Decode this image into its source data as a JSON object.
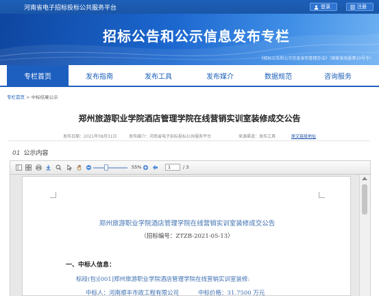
{
  "topbar": {
    "title": "河南省电子招标投标公共服务平台",
    "login_label": "登录",
    "register_label": "注册"
  },
  "banner": {
    "heading": "招标公告和公示信息发布专栏",
    "notice": "《招标公告和公示信息发布管理办法》（国家发改委第10号令）"
  },
  "nav": {
    "tabs": [
      {
        "label": "专栏首页",
        "active": true
      },
      {
        "label": "发布指南"
      },
      {
        "label": "发布工具"
      },
      {
        "label": "发布媒介"
      },
      {
        "label": "数据规范"
      },
      {
        "label": "咨询服务"
      }
    ]
  },
  "breadcrumb": {
    "home": "专栏首页",
    "sep": " > ",
    "current": "中标结果公示"
  },
  "article": {
    "title": "郑州旅游职业学院酒店管理学院在线营销实训室装修成交公告",
    "publish_date": "发布日期：2021年08月31日",
    "media": "发布媒介：河南省电子招标投标公共服务平台",
    "source": "来源渠道：发布工具",
    "source_link": "原文链接地址"
  },
  "section": {
    "num": "01",
    "label": "公示内容"
  },
  "viewer": {
    "zoom": "55%",
    "page": "1",
    "page_total": "/ 3"
  },
  "doc": {
    "title": "郑州旅游职业学院酒店管理学院在线营销实训室装修成交公告",
    "code": "（招标编号：ZTZB-2021-05-13）",
    "section_heading": "一、中标人信息：",
    "lot_line": "标段(包)[001]郑州旅游职业学院酒店管理学院在线营销实训室装修:",
    "winner_label": "中标人：",
    "winner": "河南顺丰市政工程有限公司",
    "price_label": "中标价格：",
    "price": "31.7500 万元"
  },
  "colors": {
    "primary": "#1c5fbf",
    "doc_blue": "#3c6fb0"
  }
}
